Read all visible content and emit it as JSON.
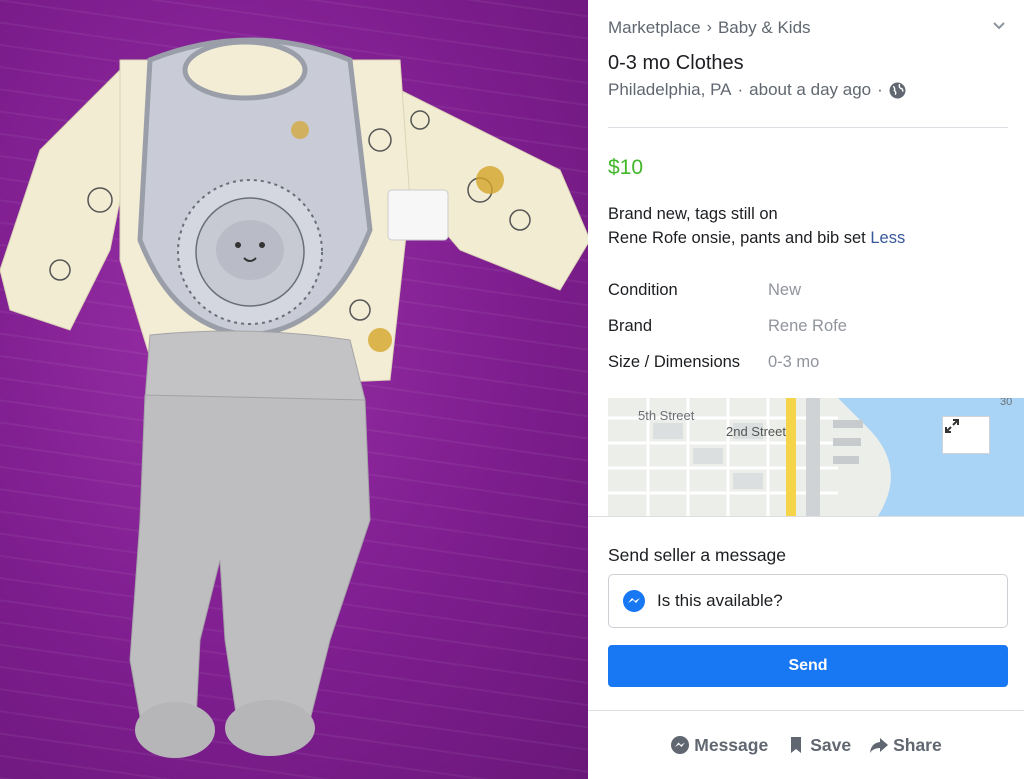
{
  "breadcrumb": {
    "section": "Marketplace",
    "separator": "›",
    "category": "Baby & Kids"
  },
  "listing": {
    "title": "0-3 mo Clothes",
    "location": "Philadelphia, PA",
    "time": "about a day ago",
    "dot": "·",
    "price": "$10",
    "description_line1": "Brand new, tags still on",
    "description_line2": "Rene Rofe onsie, pants and bib set",
    "less_link": "Less"
  },
  "attributes": [
    {
      "key": "Condition",
      "value": "New"
    },
    {
      "key": "Brand",
      "value": "Rene Rofe"
    },
    {
      "key": "Size / Dimensions",
      "value": "0-3 mo"
    }
  ],
  "map": {
    "label_street_1": "5th Street",
    "label_street_2": "2nd Street",
    "label_route": "30"
  },
  "message": {
    "heading": "Send seller a message",
    "input_value": "Is this available?",
    "send_label": "Send"
  },
  "actions": {
    "message_label": "Message",
    "save_label": "Save",
    "share_label": "Share"
  },
  "icons": [
    "chevron-down-icon",
    "globe-icon",
    "expand-icon",
    "messenger-icon",
    "bookmark-icon",
    "share-arrow-icon"
  ],
  "colors": {
    "price": "#42b72a",
    "link": "#385898",
    "send_button": "#1877f2",
    "muted": "#606770"
  }
}
